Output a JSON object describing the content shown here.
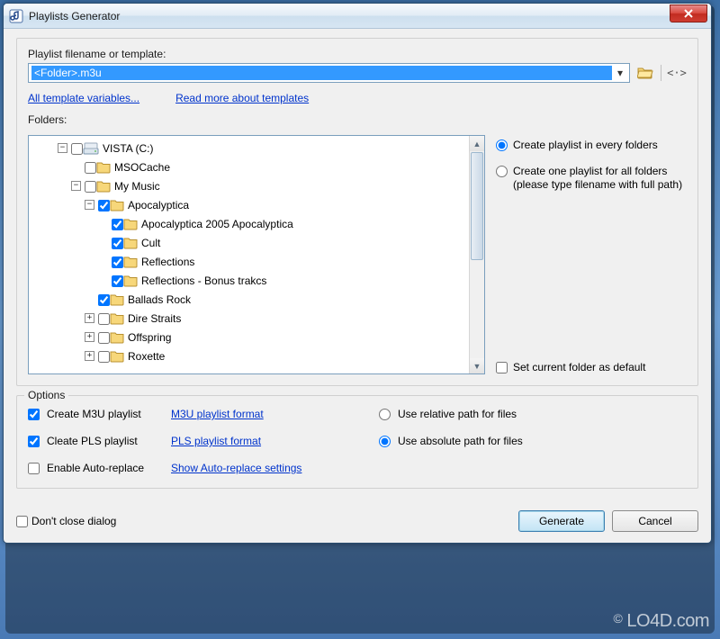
{
  "window": {
    "title": "Playlists Generator"
  },
  "main": {
    "filename_label": "Playlist filename or template:",
    "filename_value": "<Folder>.m3u",
    "link_all_vars": "All template variables...",
    "link_read_more": "Read more about templates",
    "folders_label": "Folders:"
  },
  "tree": {
    "drive": "VISTA (C:)",
    "items": [
      "MSOCache",
      "My Music",
      "Apocalyptica",
      "Apocalyptica 2005 Apocalyptica",
      "Cult",
      "Reflections",
      "Reflections - Bonus trakcs",
      "Ballads Rock",
      "Dire Straits",
      "Offspring",
      "Roxette"
    ]
  },
  "side": {
    "radio_every": "Create playlist in every folders",
    "radio_one": "Create one playlist for all folders (please type filename with full path)",
    "check_default": "Set current folder as default"
  },
  "options": {
    "title": "Options",
    "create_m3u": "Create M3U playlist",
    "link_m3u": "M3U playlist format",
    "create_pls": "Cleate PLS playlist",
    "link_pls": "PLS playlist format",
    "enable_auto": "Enable Auto-replace",
    "link_auto": "Show Auto-replace settings",
    "radio_relative": "Use relative path for files",
    "radio_absolute": "Use absolute path for files"
  },
  "footer": {
    "dont_close": "Don't close dialog",
    "generate": "Generate",
    "cancel": "Cancel"
  },
  "watermark": "LO4D.com"
}
